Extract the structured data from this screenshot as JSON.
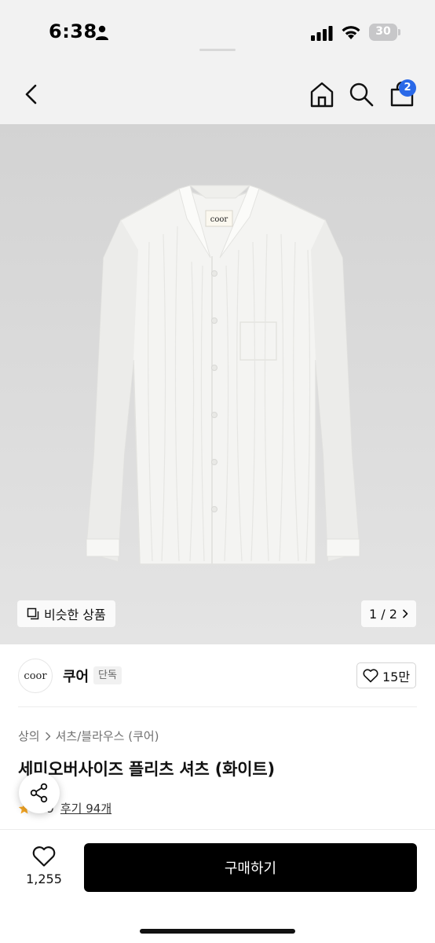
{
  "status_bar": {
    "time": "6:38",
    "battery": "30"
  },
  "nav": {
    "cart_badge": "2"
  },
  "image": {
    "logo_label": "coor",
    "similar_label": "비슷한 상품",
    "page_indicator": "1 / 2"
  },
  "brand": {
    "logo_text": "coor",
    "name": "쿠어",
    "tag": "단독",
    "likes": "15만"
  },
  "breadcrumb": {
    "category": "상의",
    "subcategory": "셔츠/블라우스 (쿠어)"
  },
  "product": {
    "title": "세미오버사이즈 플리츠 셔츠 (화이트)",
    "rating": "4.9",
    "reviews": "후기 94개"
  },
  "bottom": {
    "wish_count": "1,255",
    "buy_label": "구매하기"
  },
  "colors": {
    "badge": "#2a69e8",
    "buy_button": "#000000",
    "star": "#f5a623"
  }
}
